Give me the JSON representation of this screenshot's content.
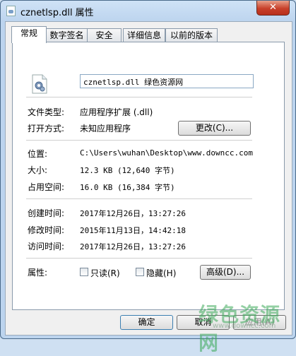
{
  "window": {
    "title": "cznetlsp.dll 属性",
    "close_label": "✕"
  },
  "tabs": [
    {
      "label": "常规",
      "active": true
    },
    {
      "label": "数字签名"
    },
    {
      "label": "安全"
    },
    {
      "label": "详细信息"
    },
    {
      "label": "以前的版本"
    }
  ],
  "general": {
    "file_name": "cznetlsp.dll 绿色资源网",
    "file_type_label": "文件类型:",
    "file_type_value": "应用程序扩展 (.dll)",
    "opens_with_label": "打开方式:",
    "opens_with_value": "未知应用程序",
    "change_button": "更改(C)...",
    "location_label": "位置:",
    "location_value": "C:\\Users\\wuhan\\Desktop\\www.downcc.com",
    "size_label": "大小:",
    "size_value": "12.3 KB (12,640 字节)",
    "size_on_disk_label": "占用空间:",
    "size_on_disk_value": "16.0 KB (16,384 字节)",
    "created_label": "创建时间:",
    "created_value": "2017年12月26日，13:27:26",
    "modified_label": "修改时间:",
    "modified_value": "2015年11月13日，14:42:18",
    "accessed_label": "访问时间:",
    "accessed_value": "2017年12月26日，13:27:26",
    "attributes_label": "属性:",
    "readonly_label": "只读(R)",
    "hidden_label": "隐藏(H)",
    "advanced_button": "高级(D)..."
  },
  "footer": {
    "ok_button": "确定",
    "cancel_button": "取消",
    "apply_button": "应用(A)"
  },
  "watermark": {
    "text": "绿色资源网",
    "url": "www.downcc.com"
  },
  "icons": {
    "title": "dll-file-icon",
    "file": "dll-gear-file-icon"
  }
}
